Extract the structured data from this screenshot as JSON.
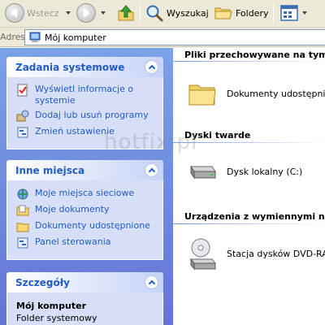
{
  "toolbar": {
    "back_label": "Wstecz",
    "search_label": "Wyszukaj",
    "folders_label": "Foldery"
  },
  "address": {
    "label": "Adres",
    "value": "Mój komputer"
  },
  "sidebar": {
    "system_tasks": {
      "title": "Zadania systemowe",
      "items": [
        {
          "label": "Wyświetl informacje o systemie",
          "icon": "system-info-icon"
        },
        {
          "label": "Dodaj lub usuń programy",
          "icon": "add-remove-programs-icon"
        },
        {
          "label": "Zmień ustawienie",
          "icon": "control-panel-icon"
        }
      ]
    },
    "other_places": {
      "title": "Inne miejsca",
      "items": [
        {
          "label": "Moje miejsca sieciowe",
          "icon": "network-places-icon"
        },
        {
          "label": "Moje dokumenty",
          "icon": "my-documents-icon"
        },
        {
          "label": "Dokumenty udostępnione",
          "icon": "shared-documents-icon"
        },
        {
          "label": "Panel sterowania",
          "icon": "control-panel-icon"
        }
      ]
    },
    "details": {
      "title": "Szczegóły",
      "name": "Mój komputer",
      "type": "Folder systemowy"
    }
  },
  "main": {
    "groups": [
      {
        "header": "Pliki przechowywane na tym ko",
        "item": "Dokumenty udostępnione"
      },
      {
        "header": "Dyski twarde",
        "item": "Dysk lokalny (C:)"
      },
      {
        "header": "Urządzenia z wymiennymi nośn",
        "item": "Stacja dysków DVD-RAM"
      }
    ]
  },
  "watermark": "hotfix.pl",
  "colors": {
    "link": "#215dc6",
    "sidebar_top": "#7ba2e7",
    "sidebar_bottom": "#6375d6",
    "panel_body": "#d6dff7"
  }
}
